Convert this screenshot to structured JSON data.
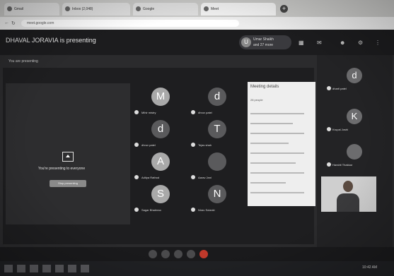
{
  "browser": {
    "tabs": [
      {
        "label": "Gmail",
        "active": false
      },
      {
        "label": "Inbox (2,048)",
        "active": false
      },
      {
        "label": "Google",
        "active": false
      },
      {
        "label": "Meet",
        "active": true
      }
    ],
    "url": "meet.google.com"
  },
  "meet": {
    "presenting_banner": "DHAVAL JORAVIA is presenting",
    "user_pill": {
      "avatar": "U",
      "line1": "Umar Shaikh",
      "line2": "and 27 more"
    },
    "you_are_presenting": "You are presenting",
    "share_text": "You're presenting to everyone",
    "stop_button": "Stop presenting",
    "tiles": [
      {
        "letter": "M",
        "name": "Mihir mistry",
        "dark": false
      },
      {
        "letter": "d",
        "name": "dhruv patel",
        "dark": true
      },
      {
        "letter": "d",
        "name": "dhruv patel",
        "dark": true
      },
      {
        "letter": "T",
        "name": "Tejas shah",
        "dark": true
      },
      {
        "letter": "A",
        "name": "Aditya Rathod",
        "dark": false
      },
      {
        "letter": "",
        "name": "Aarav Jani",
        "dark": true
      },
      {
        "letter": "S",
        "name": "Sagar Bhalerao",
        "dark": false
      },
      {
        "letter": "N",
        "name": "Nirav Solanki",
        "dark": true
      }
    ],
    "people_panel": {
      "title": "Meeting details",
      "subtitle": "28 people"
    },
    "right_tiles": [
      {
        "letter": "d",
        "name": "dharti patel"
      },
      {
        "letter": "K",
        "name": "Krupal Joshi"
      },
      {
        "letter": "",
        "name": "Harshit Thakkar"
      }
    ],
    "clock": "10:42 AM"
  }
}
